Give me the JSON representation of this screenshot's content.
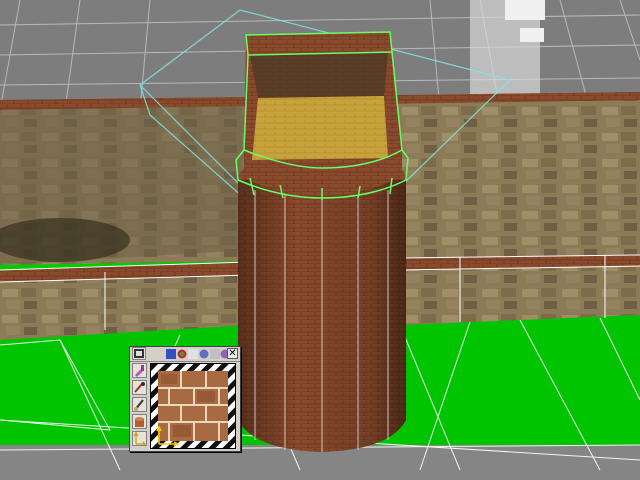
{
  "viewport": {
    "colors": {
      "ground": "#00cc00",
      "wireframe_white": "#ffffff",
      "wireframe_cyan": "#7fe6e6",
      "selection_green": "#66ff66",
      "brick": "#8a4a2c",
      "roof": "#c8a030",
      "wall_stone": "#8a7a5a",
      "grid_bg": "#7a7a7a"
    }
  },
  "texture_panel": {
    "close_label": "✕",
    "tools": [
      {
        "name": "film-icon"
      },
      {
        "name": "paint-icon"
      },
      {
        "name": "pipette-icon"
      },
      {
        "name": "brush-icon"
      },
      {
        "name": "scale-icon"
      }
    ],
    "swatches": [
      "#3050c0",
      "#c03030",
      "#e0e0e0",
      "#40a040",
      "#c0c0c0",
      "#9060c0"
    ]
  }
}
